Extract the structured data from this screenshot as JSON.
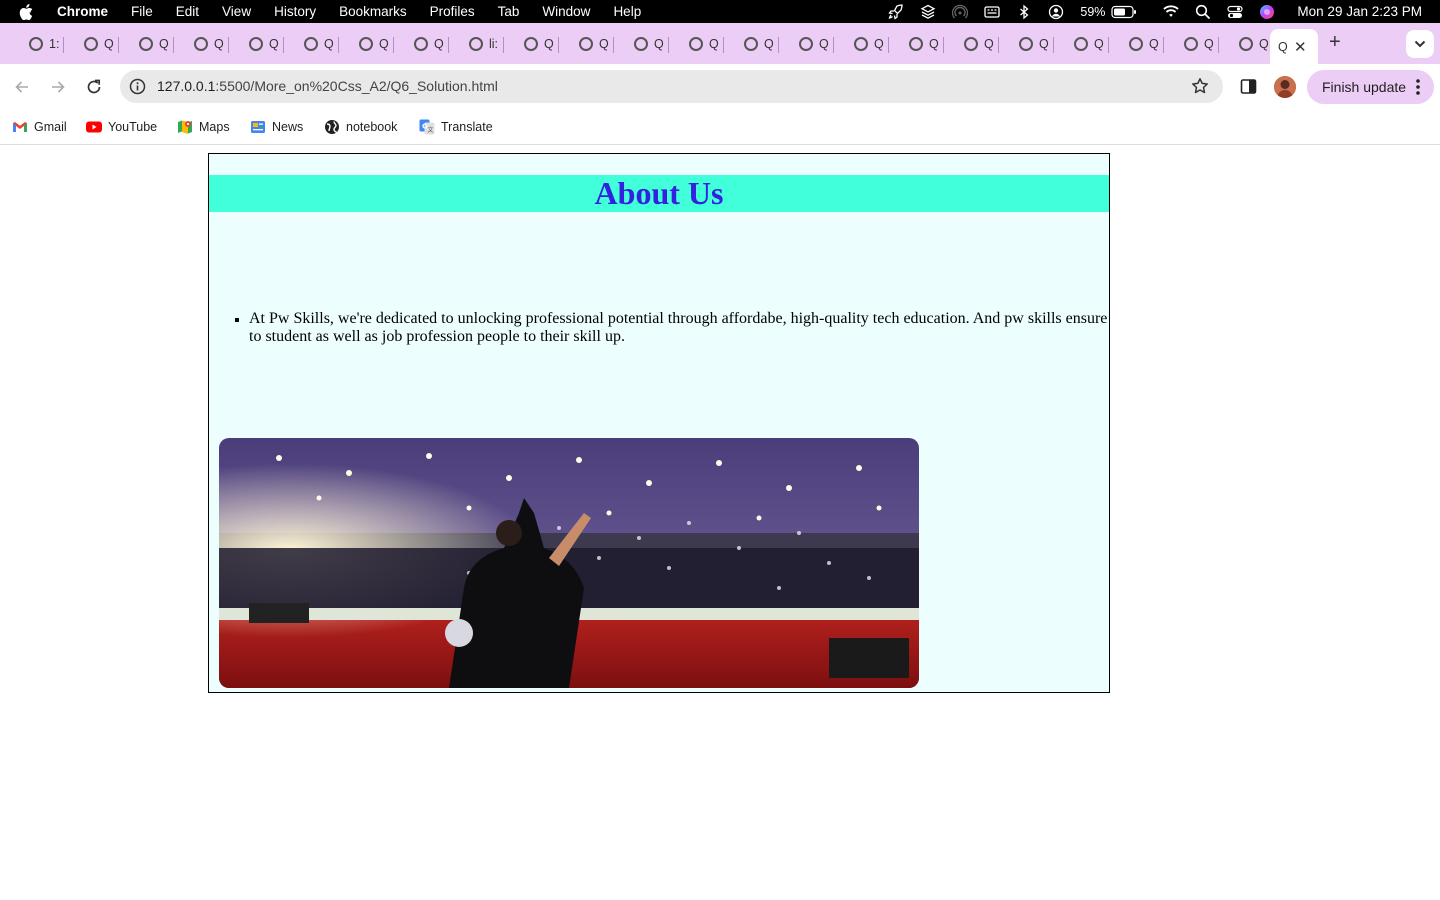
{
  "menubar": {
    "app": "Chrome",
    "menus": [
      "File",
      "Edit",
      "View",
      "History",
      "Bookmarks",
      "Profiles",
      "Tab",
      "Window",
      "Help"
    ],
    "battery": "59%",
    "clock": "Mon 29 Jan  2:23 PM"
  },
  "tabs": {
    "items": [
      {
        "label": "1:"
      },
      {
        "label": "Q"
      },
      {
        "label": "Q"
      },
      {
        "label": "Q"
      },
      {
        "label": "Q"
      },
      {
        "label": "Q"
      },
      {
        "label": "Q"
      },
      {
        "label": "Q"
      },
      {
        "label": "li:"
      },
      {
        "label": "Q"
      },
      {
        "label": "Q"
      },
      {
        "label": "Q"
      },
      {
        "label": "Q"
      },
      {
        "label": "Q"
      },
      {
        "label": "Q"
      },
      {
        "label": "Q"
      },
      {
        "label": "Q"
      },
      {
        "label": "Q"
      },
      {
        "label": "Q"
      },
      {
        "label": "Q"
      },
      {
        "label": "Q"
      },
      {
        "label": "Q"
      },
      {
        "label": "Q"
      }
    ],
    "active_label": "Q"
  },
  "toolbar": {
    "url_host": "127.0.0.1",
    "url_path": ":5500/More_on%20Css_A2/Q6_Solution.html",
    "finish_update": "Finish update"
  },
  "bookmarks": [
    {
      "label": "Gmail",
      "icon": "gmail-icon"
    },
    {
      "label": "YouTube",
      "icon": "youtube-icon"
    },
    {
      "label": "Maps",
      "icon": "maps-icon"
    },
    {
      "label": "News",
      "icon": "news-icon"
    },
    {
      "label": "notebook",
      "icon": "globe-icon"
    },
    {
      "label": "Translate",
      "icon": "translate-icon"
    }
  ],
  "content": {
    "heading": "About Us",
    "list_item": "At Pw Skills, we're dedicated to unlocking professional potential through affordabe, high-quality tech education. And pw skills ensure to student as well as job profession people to their skill up."
  },
  "colors": {
    "tab_strip": "#eccdf6",
    "heading_bar": "#40ffd9",
    "heading_text": "#3420e0",
    "container_bg": "#ecfffe"
  }
}
